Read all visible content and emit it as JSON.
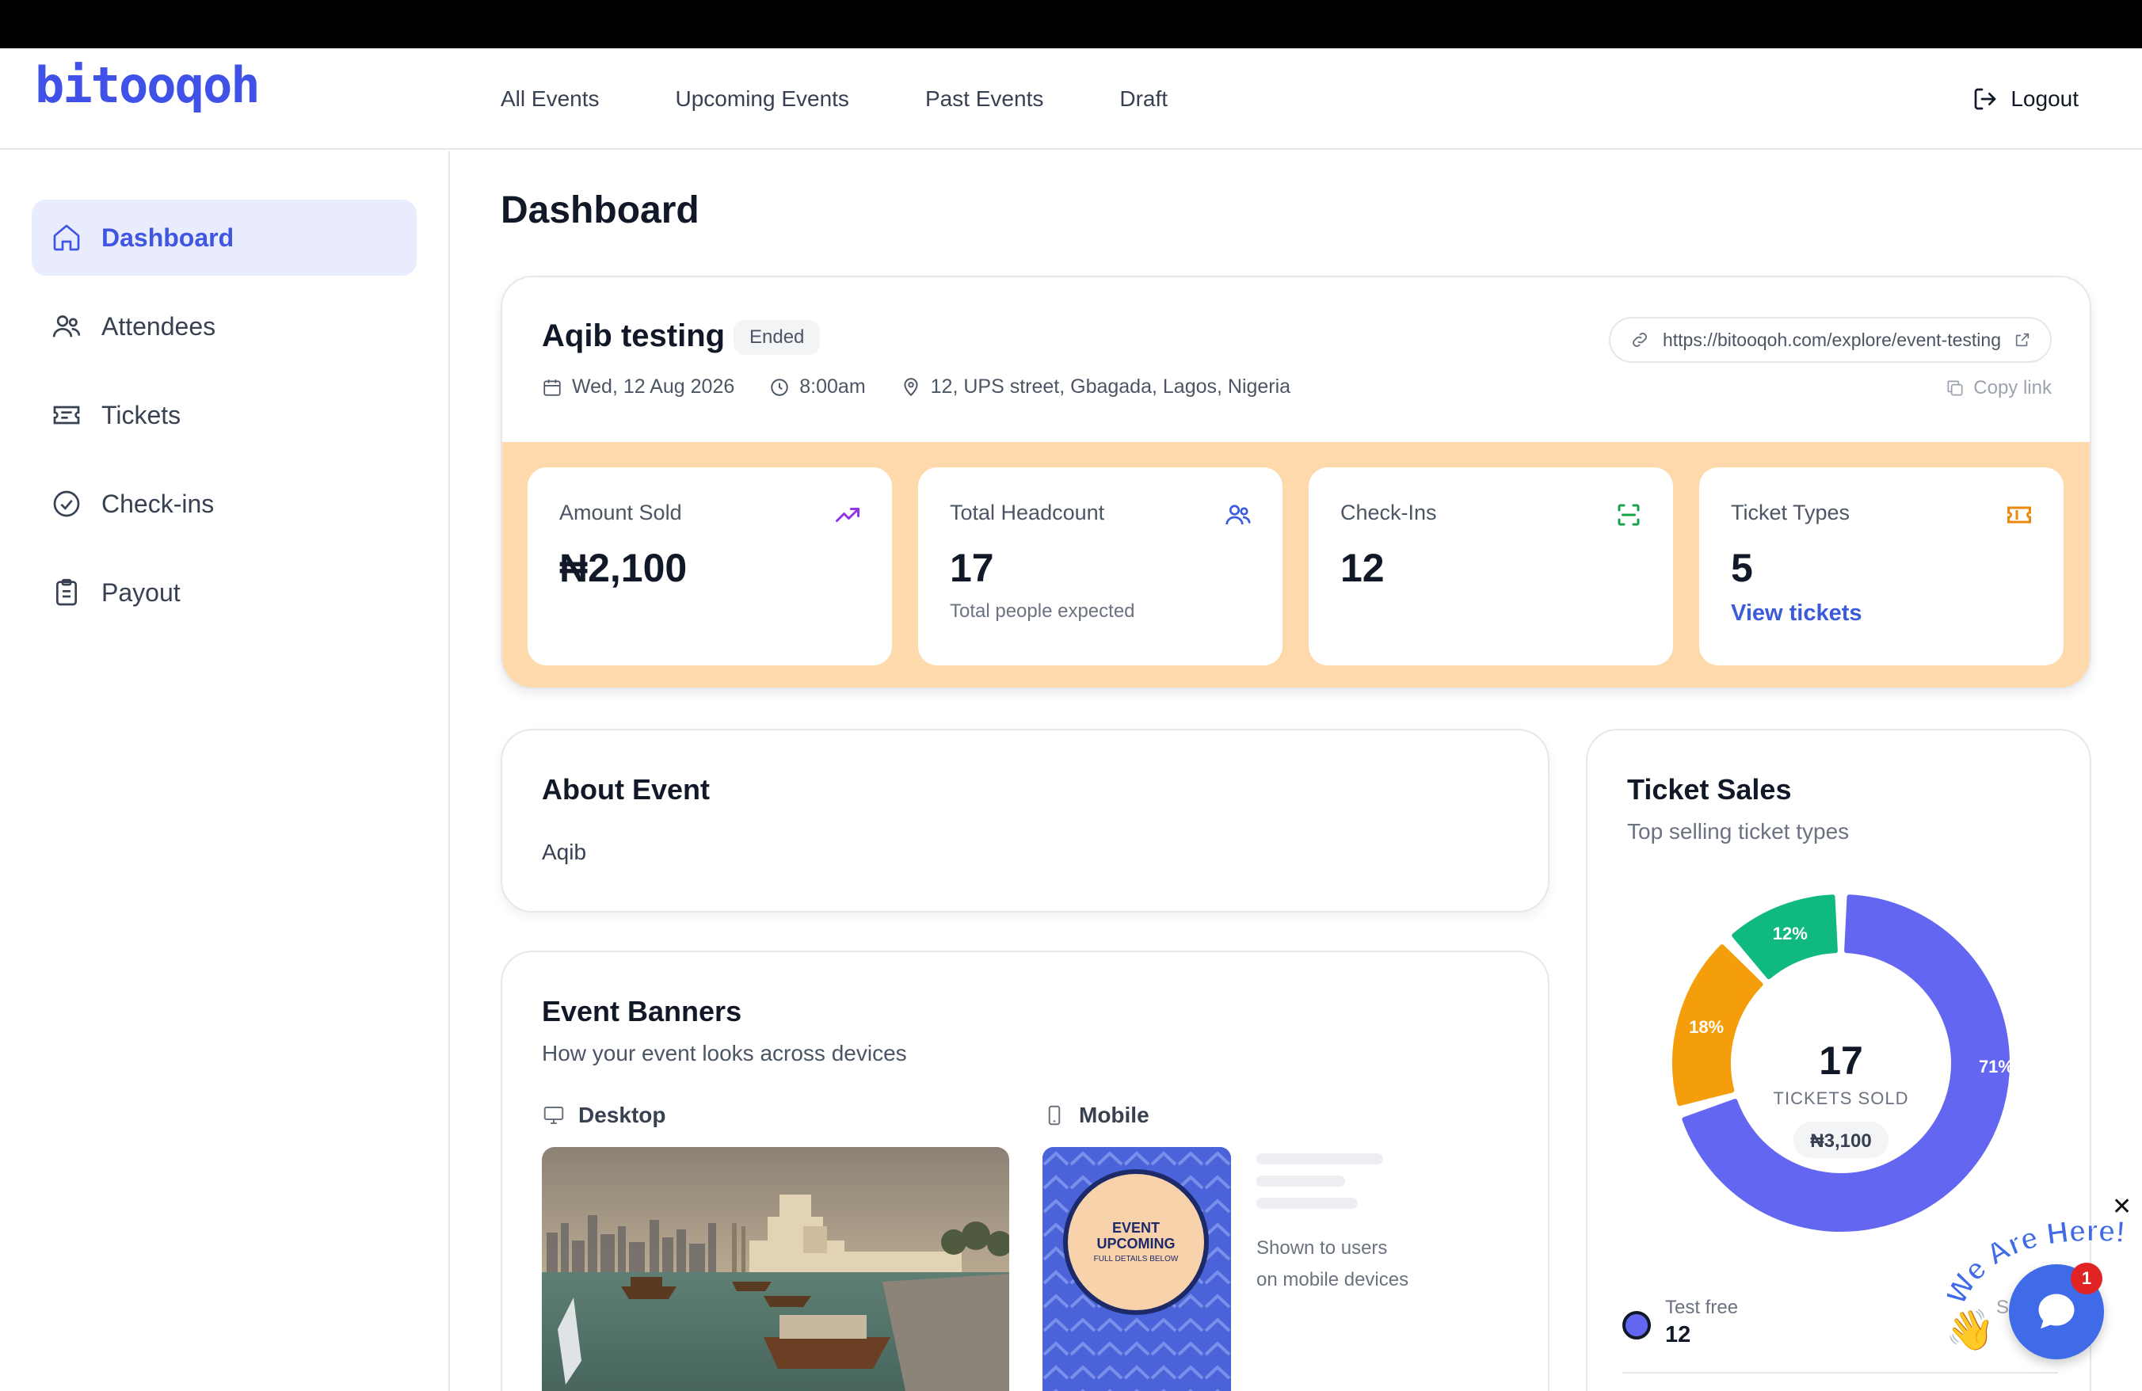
{
  "brand": {
    "logo": "bitooqoh",
    "color": "#3f51e6"
  },
  "nav": {
    "items": [
      "All Events",
      "Upcoming Events",
      "Past Events",
      "Draft"
    ],
    "logout": "Logout"
  },
  "sidebar": {
    "items": [
      {
        "label": "Dashboard",
        "icon": "home-icon",
        "active": true
      },
      {
        "label": "Attendees",
        "icon": "users-icon"
      },
      {
        "label": "Tickets",
        "icon": "ticket-icon"
      },
      {
        "label": "Check-ins",
        "icon": "check-circle-icon"
      },
      {
        "label": "Payout",
        "icon": "clipboard-icon"
      }
    ]
  },
  "page": {
    "title": "Dashboard"
  },
  "event": {
    "name": "Aqib testing",
    "status": "Ended",
    "date": "Wed, 12 Aug 2026",
    "time": "8:00am",
    "location": "12, UPS street, Gbagada, Lagos, Nigeria",
    "url": "https://bitooqoh.com/explore/event-testing",
    "copy_label": "Copy link"
  },
  "stats": [
    {
      "label": "Amount Sold",
      "value": "₦2,100",
      "sub": "",
      "icon": "trending-up-icon",
      "icon_color": "#9333ea"
    },
    {
      "label": "Total Headcount",
      "value": "17",
      "sub": "Total people expected",
      "icon": "users-icon",
      "icon_color": "#3b5bdb"
    },
    {
      "label": "Check-Ins",
      "value": "12",
      "sub": "",
      "icon": "scan-icon",
      "icon_color": "#16a34a"
    },
    {
      "label": "Ticket Types",
      "value": "5",
      "sub": "View tickets",
      "icon": "ticket-icon",
      "icon_color": "#ea8a0c"
    }
  ],
  "about": {
    "title": "About Event",
    "text": "Aqib"
  },
  "banners": {
    "title": "Event Banners",
    "subtitle": "How your event looks across devices",
    "desktop_label": "Desktop",
    "mobile_label": "Mobile",
    "mobile_note_1": "Shown to users",
    "mobile_note_2": "on mobile devices",
    "poster_line1": "EVENT",
    "poster_line2": "UPCOMING",
    "poster_line3": "FULL DETAILS BELOW"
  },
  "sales": {
    "title": "Ticket Sales",
    "subtitle": "Top selling ticket types",
    "total": "17",
    "total_label": "TICKETS SOLD",
    "amount": "₦3,100",
    "legend": [
      {
        "name": "Test free",
        "value": "12"
      }
    ]
  },
  "chart_data": {
    "type": "pie",
    "slices": [
      {
        "label": "71%",
        "value": 71,
        "color": "#6366f1"
      },
      {
        "label": "18%",
        "value": 18,
        "color": "#f59e0b"
      },
      {
        "label": "12%",
        "value": 12,
        "color": "#10b981"
      }
    ]
  },
  "chat": {
    "bubble_text": "We Are Here!",
    "badge": "1",
    "partial_legend_letter": "S"
  }
}
